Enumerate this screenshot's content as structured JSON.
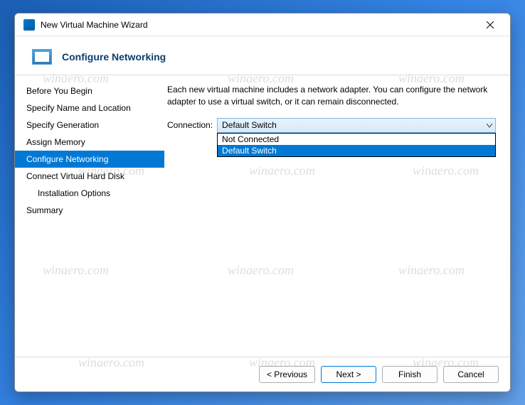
{
  "titlebar": {
    "title": "New Virtual Machine Wizard"
  },
  "header": {
    "title": "Configure Networking"
  },
  "sidebar": {
    "items": [
      {
        "label": "Before You Begin"
      },
      {
        "label": "Specify Name and Location"
      },
      {
        "label": "Specify Generation"
      },
      {
        "label": "Assign Memory"
      },
      {
        "label": "Configure Networking"
      },
      {
        "label": "Connect Virtual Hard Disk"
      },
      {
        "label": "Installation Options"
      },
      {
        "label": "Summary"
      }
    ]
  },
  "content": {
    "description": "Each new virtual machine includes a network adapter. You can configure the network adapter to use a virtual switch, or it can remain disconnected.",
    "connection_label": "Connection:",
    "connection_value": "Default Switch",
    "connection_options": [
      {
        "label": "Not Connected"
      },
      {
        "label": "Default Switch"
      }
    ]
  },
  "footer": {
    "previous": "< Previous",
    "next": "Next >",
    "finish": "Finish",
    "cancel": "Cancel"
  },
  "watermark": "winaero.com"
}
